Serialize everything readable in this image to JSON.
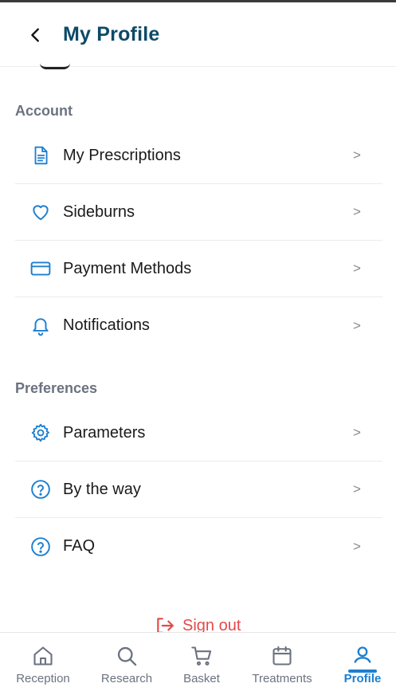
{
  "header": {
    "title": "My Profile",
    "back_icon": "chevron-left-icon"
  },
  "sections": {
    "account": {
      "title": "Account",
      "items": [
        {
          "label": "My Prescriptions",
          "icon": "document-icon",
          "chevron": ">"
        },
        {
          "label": "Sideburns",
          "icon": "heart-icon",
          "chevron": ">"
        },
        {
          "label": "Payment Methods",
          "icon": "credit-card-icon",
          "chevron": ">"
        },
        {
          "label": "Notifications",
          "icon": "bell-icon",
          "chevron": ">"
        }
      ]
    },
    "preferences": {
      "title": "Preferences",
      "items": [
        {
          "label": "Parameters",
          "icon": "gear-icon",
          "chevron": ">"
        },
        {
          "label": "By the way",
          "icon": "help-circle-icon",
          "chevron": ">"
        },
        {
          "label": "FAQ",
          "icon": "help-circle-icon",
          "chevron": ">"
        }
      ]
    }
  },
  "signout": {
    "label": "Sign out",
    "icon": "logout-icon"
  },
  "bottom_nav": {
    "items": [
      {
        "label": "Reception",
        "icon": "home-icon",
        "active": false
      },
      {
        "label": "Research",
        "icon": "search-icon",
        "active": false
      },
      {
        "label": "Basket",
        "icon": "cart-icon",
        "active": false
      },
      {
        "label": "Treatments",
        "icon": "calendar-icon",
        "active": false
      },
      {
        "label": "Profile",
        "icon": "user-icon",
        "active": true
      }
    ]
  },
  "colors": {
    "title": "#0d4a66",
    "accent": "#1d7fd0",
    "signout": "#e44a4a",
    "section_title": "#6b7280"
  }
}
